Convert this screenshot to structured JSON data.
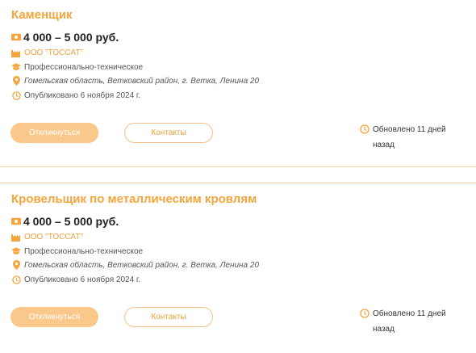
{
  "vacancies": [
    {
      "title": "Каменщик",
      "salary": "4 000 – 5 000 руб.",
      "company": "ООО \"ТОССАТ\"",
      "education": "Профессионально-техническое",
      "location": "Гомельская область, Ветковский район, г. Ветка, Ленина 20",
      "published": "Опубликовано 6 ноября 2024 г.",
      "respond_label": "Откликнуться",
      "contacts_label": "Контакты",
      "updated_line1": "Обновлено 11 дней",
      "updated_line2": "назад"
    },
    {
      "title": "Кровельщик по металлическим кровлям",
      "salary": "4 000 – 5 000 руб.",
      "company": "ООО \"ТОССАТ\"",
      "education": "Профессионально-техническое",
      "location": "Гомельская область, Ветковский район, г. Ветка, Ленина 20",
      "published": "Опубликовано 6 ноября 2024 г.",
      "respond_label": "Откликнуться",
      "contacts_label": "Контакты",
      "updated_line1": "Обновлено 11 дней",
      "updated_line2": "назад"
    }
  ],
  "icons": {
    "salary": "money-icon",
    "company": "factory-icon",
    "education": "graduation-cap-icon",
    "location": "map-pin-icon",
    "published": "clock-icon",
    "updated": "clock-icon"
  },
  "colors": {
    "accent": "#f5a53b",
    "button_fill": "#fbc88b",
    "separator": "#f5d2a4"
  }
}
